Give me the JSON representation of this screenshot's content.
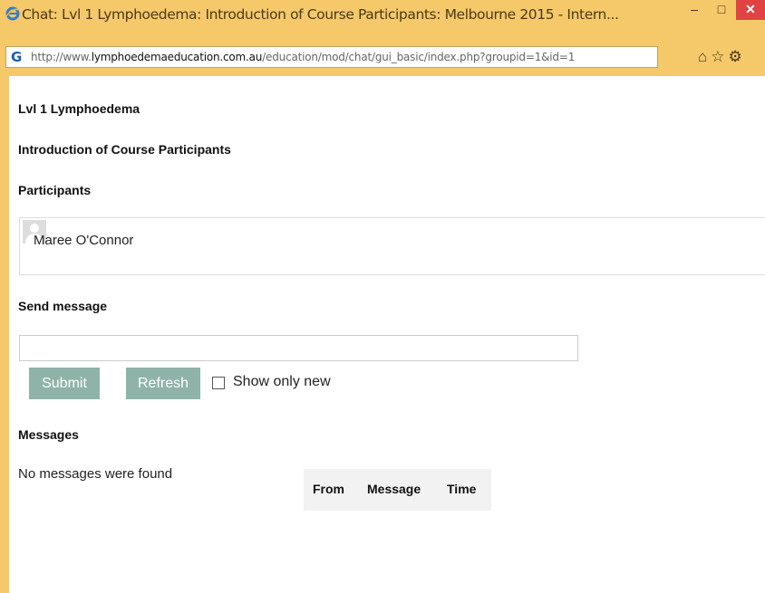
{
  "window": {
    "title": "Chat: Lvl 1 Lymphoedema: Introduction of Course Participants: Melbourne 2015 - Intern...",
    "minimize": "–",
    "maximize": "□",
    "close": "✕"
  },
  "address_bar": {
    "scheme": "http://www.",
    "domain": "lymphoedemaeducation.com.au",
    "path": "/education/mod/chat/gui_basic/index.php?groupid=1&id=1"
  },
  "nav_icons": {
    "home": "⌂",
    "favorites": "☆",
    "tools": "⚙"
  },
  "page": {
    "course_title": "Lvl 1 Lymphoedema",
    "chat_title": "Introduction of Course Participants",
    "participants_heading": "Participants",
    "participants": [
      {
        "name": "Maree O'Connor"
      }
    ],
    "send_heading": "Send message",
    "message_placeholder": "",
    "submit_label": "Submit",
    "refresh_label": "Refresh",
    "show_only_new_label": "Show only new",
    "messages_heading": "Messages",
    "no_messages_text": "No messages were found",
    "table_headers": [
      "From",
      "Message",
      "Time"
    ]
  }
}
